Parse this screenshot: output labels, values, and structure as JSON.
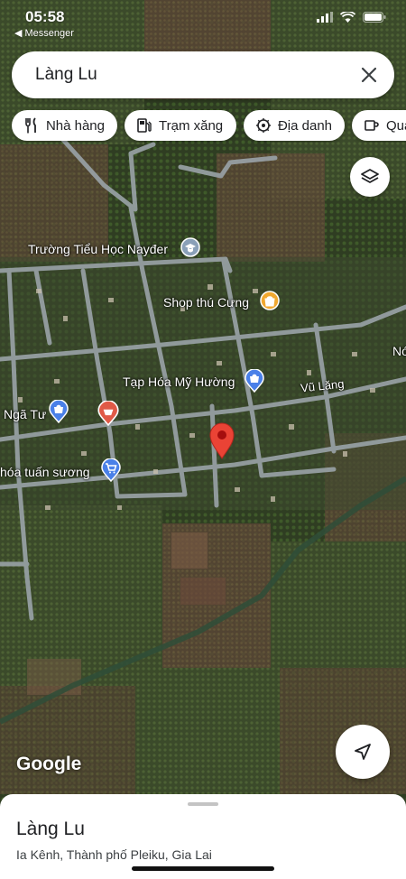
{
  "status_bar": {
    "time": "05:58",
    "back_app": "◀ Messenger"
  },
  "search": {
    "query": "Làng Lu"
  },
  "chips": [
    {
      "label": "Nhà hàng",
      "icon": "fork-knife-icon"
    },
    {
      "label": "Trạm xăng",
      "icon": "gas-station-icon"
    },
    {
      "label": "Địa danh",
      "icon": "landmark-icon"
    },
    {
      "label": "Quá",
      "icon": "cup-icon"
    }
  ],
  "map": {
    "places": [
      {
        "name": "Trường Tiểu Học Nayđer",
        "icon": "school-icon",
        "color": "#8aa0b8"
      },
      {
        "name": "Shop thú Cưng",
        "icon": "shopping-icon",
        "color": "#f0a830"
      },
      {
        "name": "Tạp Hóa Mỹ Hường",
        "icon": "shopping-bag-icon",
        "color": "#4a80e8"
      },
      {
        "name": "Ngã Tư",
        "icon": "shopping-bag-icon",
        "color": "#4a80e8"
      },
      {
        "name": "hóa tuấn sương",
        "icon": "cart-icon",
        "color": "#4a80e8"
      },
      {
        "name": "Nó",
        "icon": "",
        "color": ""
      }
    ],
    "restaurant_pin_color": "#e05a47",
    "selected_pin_color": "#ea4335",
    "road_label": "Vũ Lăng",
    "logo": "Google"
  },
  "sheet": {
    "title": "Làng Lu",
    "subtitle": "Ia Kênh, Thành phố Pleiku, Gia Lai"
  }
}
